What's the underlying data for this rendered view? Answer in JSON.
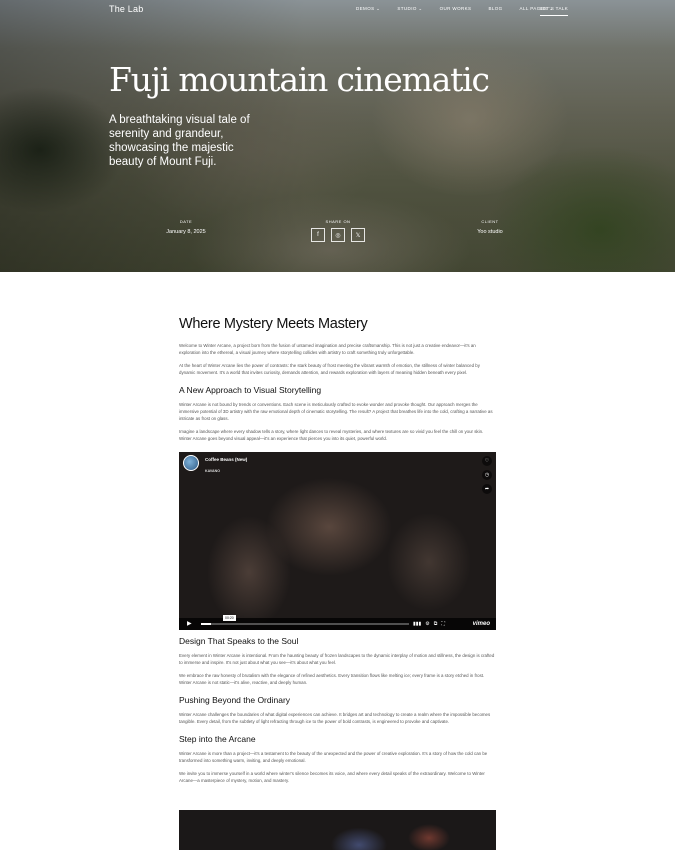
{
  "header": {
    "logo": "The Lab",
    "nav": [
      "DEMOS",
      "STUDIO",
      "OUR WORKS",
      "BLOG",
      "ALL PAGES"
    ],
    "nav_has_dropdown": [
      true,
      true,
      false,
      false,
      true
    ],
    "cta": "LET'S TALK"
  },
  "hero": {
    "title": "Fuji mountain cinematic",
    "subtitle": "A breathtaking visual tale of serenity and grandeur, showcasing the majestic beauty of Mount Fuji.",
    "date_label": "DATE",
    "date_value": "January 8, 2025",
    "share_label": "SHARE ON",
    "share_icons": [
      "facebook-icon",
      "instagram-icon",
      "x-icon"
    ],
    "share_glyphs": [
      "f",
      "◎",
      "𝕏"
    ],
    "client_label": "CLIENT",
    "client_value": "Yoo studio"
  },
  "article": {
    "title": "Where Mystery Meets Mastery",
    "p1": "Welcome to Winter Arcane, a project born from the fusion of untamed imagination and precise craftsmanship. This is not just a creative endeavor—it's an exploration into the ethereal, a visual journey where storytelling collides with artistry to craft something truly unforgettable.",
    "p2": "At the heart of Winter Arcane lies the power of contrasts: the stark beauty of frost meeting the vibrant warmth of emotion, the stillness of winter balanced by dynamic movement. It's a world that invites curiosity, demands attention, and rewards exploration with layers of meaning hidden beneath every pixel.",
    "h2_1": "A New Approach to Visual Storytelling",
    "p3": "Winter Arcane is not bound by trends or conventions. Each scene is meticulously crafted to evoke wonder and provoke thought. Our approach merges the immersive potential of 3D artistry with the raw emotional depth of cinematic storytelling. The result? A project that breathes life into the cold, crafting a narrative as intricate as frost on glass.",
    "p4": "Imagine a landscape where every shadow tells a story, where light dances to reveal mysteries, and where textures are so vivid you feel the chill on your skin. Winter Arcane goes beyond visual appeal—it's an experience that pierces you into its quiet, powerful world."
  },
  "video": {
    "title": "Coffee Beans (New)",
    "author": "KAVANO",
    "time": "00:20",
    "progress": 0.05,
    "brand": "vimeo",
    "side_icons": [
      "heart-icon",
      "clock-icon",
      "share-icon"
    ],
    "side_glyphs": [
      "♡",
      "◷",
      "➦"
    ],
    "control_glyphs": [
      "▮▮▮",
      "⚙",
      "⧉",
      "⛶"
    ],
    "play_glyph": "▶"
  },
  "article2": {
    "h2_2": "Design That Speaks to the Soul",
    "p5": "Every element in Winter Arcane is intentional. From the haunting beauty of frozen landscapes to the dynamic interplay of motion and stillness, the design is crafted to immerse and inspire. It's not just about what you see—it's about what you feel.",
    "p6": "We embrace the raw honesty of brutalism with the elegance of refined aesthetics. Every transition flows like melting ice; every frame is a story etched in frost. Winter Arcane is not static—it's alive, reactive, and deeply human.",
    "h2_3": "Pushing Beyond the Ordinary",
    "p7": "Winter Arcane challenges the boundaries of what digital experiences can achieve. It bridges art and technology to create a realm where the impossible becomes tangible. Every detail, from the subtlety of light refracting through ice to the power of bold contrasts, is engineered to provoke and captivate.",
    "h2_4": "Step into the Arcane",
    "p8": "Winter Arcane is more than a project—it's a testament to the beauty of the unexpected and the power of creative exploration. It's a story of how the cold can be transformed into something warm, inviting, and deeply emotional.",
    "p9": "We invite you to immerse yourself in a world where winter's silence becomes its voice, and where every detail speaks of the extraordinary. Welcome to Winter Arcane—a masterpiece of mystery, motion, and mastery."
  }
}
